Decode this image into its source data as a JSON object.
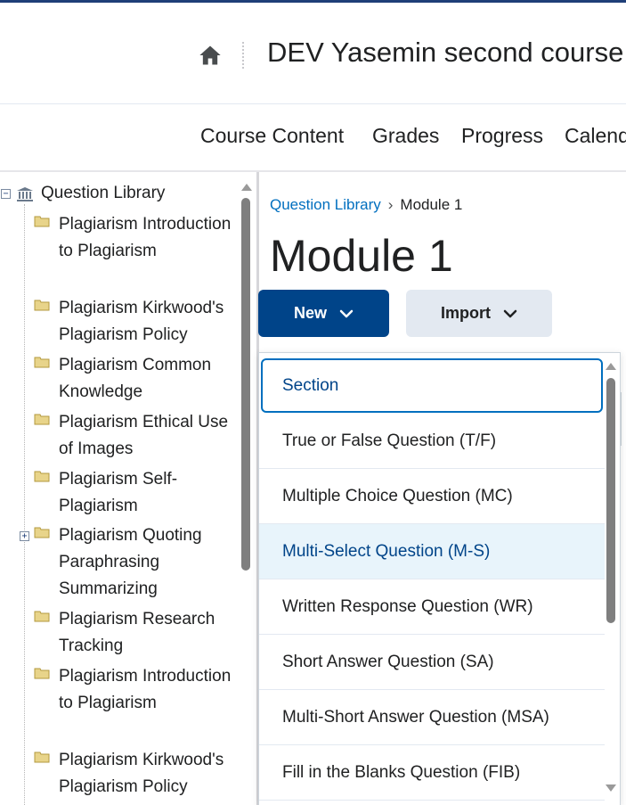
{
  "header": {
    "home_icon": "home-icon",
    "course_title": "DEV Yasemin second course"
  },
  "nav": {
    "items": [
      "Course Content",
      "Grades",
      "Progress",
      "Calendar"
    ]
  },
  "tree": {
    "root_label": "Question Library",
    "root_toggle": "⊟",
    "items": [
      {
        "label": "Plagiarism Introduction to Plagiarism"
      },
      {
        "label": "Plagiarism Kirkwood's Plagiarism Policy"
      },
      {
        "label": "Plagiarism Common Knowledge"
      },
      {
        "label": "Plagiarism Ethical Use of Images"
      },
      {
        "label": "Plagiarism Self-Plagiarism"
      },
      {
        "label": "Plagiarism Quoting Paraphrasing Summarizing",
        "expandable": true
      },
      {
        "label": "Plagiarism Research Tracking"
      },
      {
        "label": "Plagiarism Introduction to Plagiarism"
      },
      {
        "label": "Plagiarism Kirkwood's Plagiarism Policy"
      }
    ]
  },
  "breadcrumb": {
    "link": "Question Library",
    "separator": "›",
    "current": "Module 1"
  },
  "page_title": "Module 1",
  "buttons": {
    "new_label": "New",
    "import_label": "Import"
  },
  "menu": {
    "items": [
      "Section",
      "True or False Question (T/F)",
      "Multiple Choice Question (MC)",
      "Multi-Select Question (M-S)",
      "Written Response Question (WR)",
      "Short Answer Question (SA)",
      "Multi-Short Answer Question (MSA)",
      "Fill in the Blanks Question (FIB)"
    ],
    "focused_item": "Section",
    "hovered_item": "Multi-Select Question (M-S)"
  },
  "colors": {
    "primary": "#004489",
    "link": "#006fbf",
    "hover_bg": "#e8f4fb",
    "secondary_button": "#e3e9f1"
  }
}
